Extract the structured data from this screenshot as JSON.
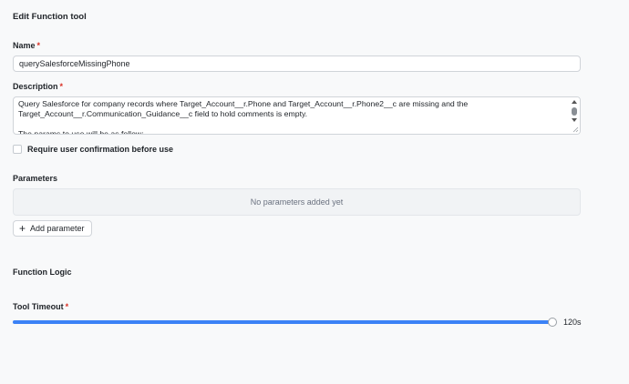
{
  "dialog": {
    "title": "Edit Function tool"
  },
  "name_field": {
    "label": "Name",
    "required_mark": "*",
    "value": "querySalesforceMissingPhone"
  },
  "description_field": {
    "label": "Description",
    "required_mark": "*",
    "value": "Query Salesforce for company records where Target_Account__r.Phone and Target_Account__r.Phone2__c are missing and the\nTarget_Account__r.Communication_Guidance__c field to hold comments is empty.\n\nThe params to use will be as follow:"
  },
  "confirmation": {
    "label": "Require user confirmation before use",
    "checked": false
  },
  "parameters": {
    "label": "Parameters",
    "empty_text": "No parameters added yet",
    "add_button_label": "Add parameter",
    "add_button_icon": "plus-icon"
  },
  "function_logic": {
    "label": "Function Logic"
  },
  "timeout": {
    "label": "Tool Timeout",
    "required_mark": "*",
    "value_text": "120s",
    "fill_fraction": 1.0
  },
  "colors": {
    "accent": "#3b82f6",
    "required": "#d93025",
    "background": "#f8f9fa"
  }
}
